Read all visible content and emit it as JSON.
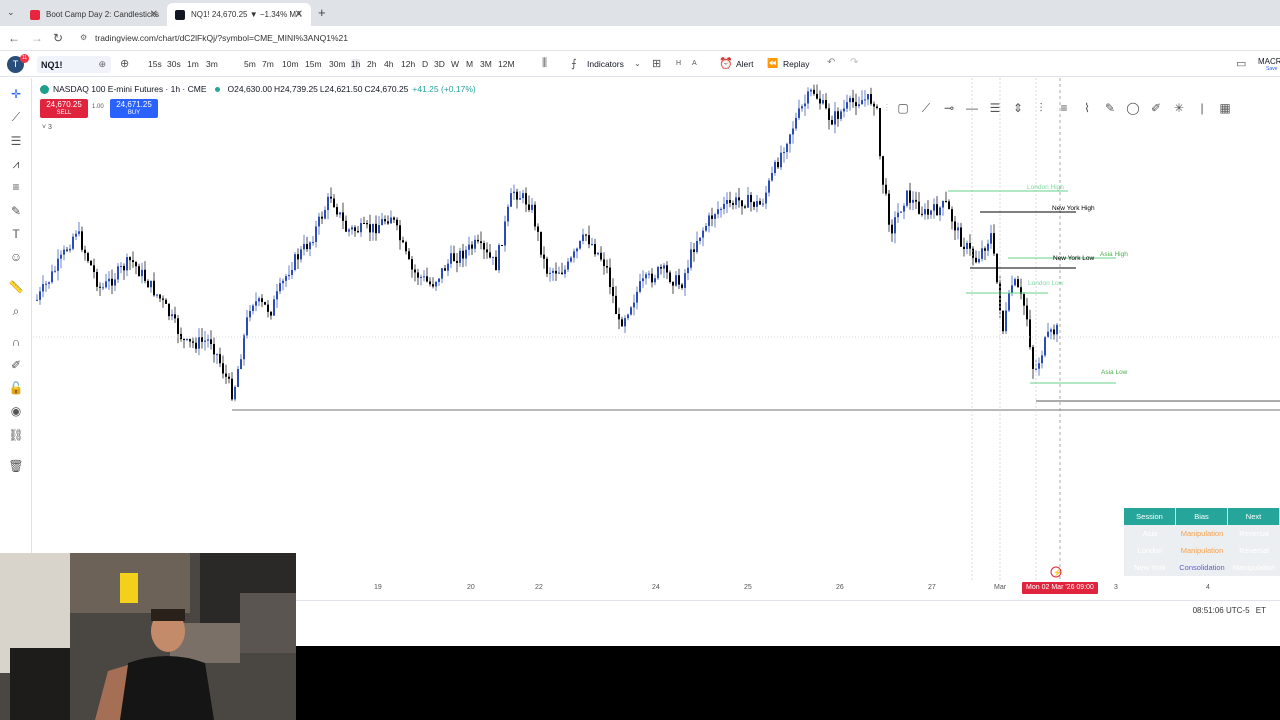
{
  "browser": {
    "tabs": [
      {
        "title": "Boot Camp Day 2: Candlesticks",
        "active": false
      },
      {
        "title": "NQ1! 24,670.25 ▼ −1.34% MA",
        "active": true
      }
    ],
    "url": "tradingview.com/chart/dC2lFkQj/?symbol=CME_MINI%3ANQ1%21"
  },
  "toolbar": {
    "symbol": "NQ1!",
    "timeframes": [
      "15s",
      "30s",
      "1m",
      "3m",
      "5m",
      "7m",
      "10m",
      "15m",
      "30m",
      "1h",
      "2h",
      "4h",
      "12h",
      "D",
      "3D",
      "W",
      "M",
      "3M",
      "12M"
    ],
    "selected_timeframe": "1h",
    "indicators_label": "Indicators",
    "alert_label": "Alert",
    "replay_label": "Replay",
    "right_label": "MACR",
    "right_sub": "Save"
  },
  "legend": {
    "title": "NASDAQ 100 E-mini Futures · 1h · CME",
    "open": "O24,630.00",
    "high": "H24,739.25",
    "low": "L24,621.50",
    "close": "C24,670.25",
    "change": "+41.25 (+0.17%)",
    "sell_price": "24,670.25",
    "sell_label": "SELL",
    "buy_price": "24,671.25",
    "buy_label": "BUY",
    "spread": "1.00",
    "collapse": "˅ 3"
  },
  "chart_levels": {
    "london_high": "London High",
    "new_york_high": "New York High",
    "asia_high": "Asia High",
    "new_york_low": "New York Low",
    "london_low": "London Low",
    "asia_low": "Asia Low"
  },
  "session_table": {
    "headers": [
      "Session",
      "Bias",
      "Next"
    ],
    "rows": [
      [
        "Asia",
        "Manipulation",
        "Reversal"
      ],
      [
        "London",
        "Manipulation",
        "Reversal"
      ],
      [
        "New York",
        "Consolidation",
        "Manipulation"
      ]
    ],
    "colors": {
      "header": "#26a69a",
      "manipulation": "#f7a04b",
      "consolidation": "#5b5fcf"
    }
  },
  "time_axis": {
    "labels": [
      "19",
      "20",
      "22",
      "24",
      "25",
      "26",
      "27",
      "Mar",
      "3",
      "4"
    ],
    "cursor_date": "Mon 02 Mar '26  09:00"
  },
  "status": {
    "clock": "08:51:06 UTC-5",
    "clock_suffix": "ET"
  },
  "colors": {
    "bull": "#2b4bb5",
    "bear": "#000000",
    "sell": "#e0243d",
    "buy": "#2962ff",
    "level_green": "#4caf50",
    "level_black": "#000000"
  }
}
